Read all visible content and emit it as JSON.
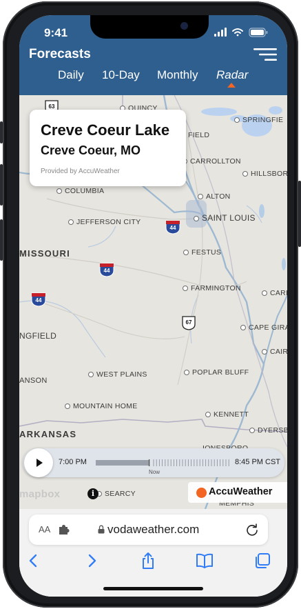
{
  "status": {
    "time": "9:41"
  },
  "header": {
    "title": "Forecasts",
    "tabs": [
      {
        "label": "Daily"
      },
      {
        "label": "10-Day"
      },
      {
        "label": "Monthly"
      },
      {
        "label": "Radar",
        "active": true
      }
    ]
  },
  "location_card": {
    "title": "Creve Coeur Lake",
    "subtitle": "Creve Coeur, MO",
    "provider": "Provided by AccuWeather"
  },
  "map": {
    "cities": [
      "QUINCY",
      "FIELD",
      "SPRINGFIE",
      "CARROLLTON",
      "HILLSBORO",
      "COLUMBIA",
      "ALTON",
      "JEFFERSON CITY",
      "SAINT LOUIS",
      "FESTUS",
      "FARMINGTON",
      "CARBO",
      "CAPE GIRAR",
      "CAIRO",
      "WEST PLAINS",
      "POPLAR BLUFF",
      "MOUNTAIN HOME",
      "KENNETT",
      "DYERSBU",
      "SEARCY",
      "IONESBORO",
      "MEMPHIS"
    ],
    "state_labels": [
      "MISSOURI",
      "NGFIELD",
      "ANSON",
      "ARKANSAS"
    ],
    "highway_shields": [
      "63",
      "44",
      "44",
      "44",
      "67"
    ]
  },
  "timeline": {
    "start_label": "7:00 PM",
    "end_label": "8:45 PM CST",
    "now_label": "Now",
    "progress": 0.4
  },
  "attribution": {
    "mapbox": "mapbox",
    "accuweather": "AccuWeather"
  },
  "browser": {
    "aa_label": "AA",
    "url": "vodaweather.com"
  },
  "colors": {
    "header_bg": "#2f5f8f",
    "accent": "#f26522",
    "map_bg": "#e8e6e1"
  },
  "icons": [
    "menu-icon",
    "play-icon",
    "info-icon",
    "extension-icon",
    "lock-icon",
    "reload-icon",
    "back-icon",
    "forward-icon",
    "share-icon",
    "bookmarks-icon",
    "tabs-icon"
  ]
}
